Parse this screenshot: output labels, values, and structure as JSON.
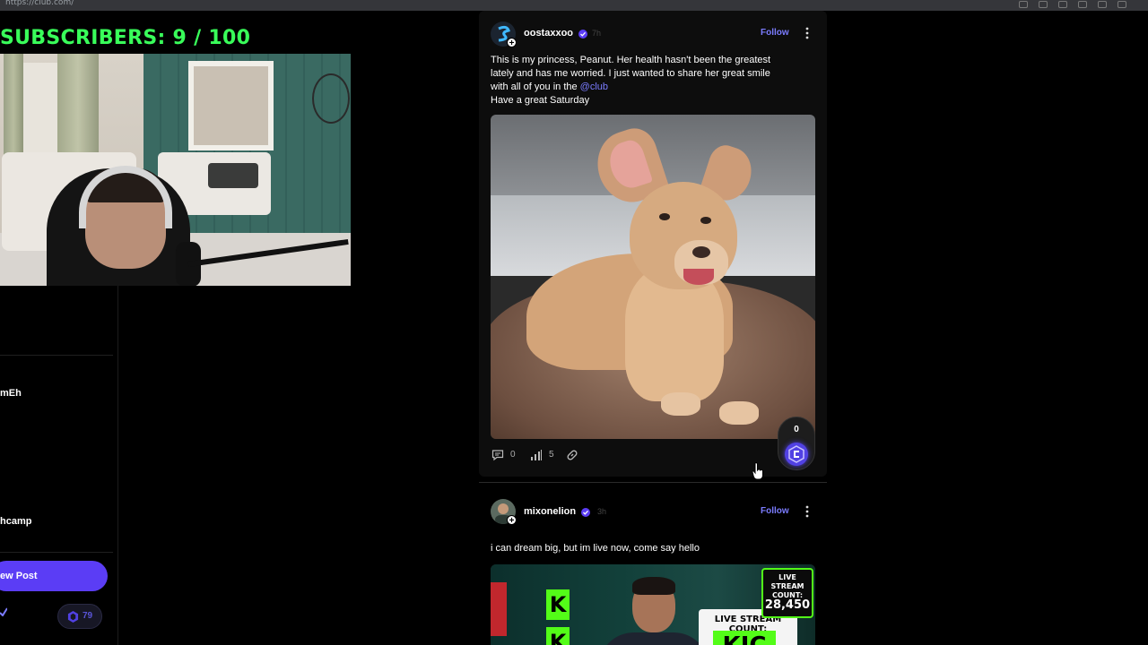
{
  "browser": {
    "url": "https://club.com/"
  },
  "stream_overlay": {
    "subscribers_label": "SUBSCRIBERS: 9 / 100"
  },
  "sidebar": {
    "items": [
      {
        "label": "mEh"
      },
      {
        "label": "hcamp"
      }
    ],
    "new_post_label": "ew Post",
    "points": "79"
  },
  "feed": {
    "posts": [
      {
        "username": "oostaxxoo",
        "time_ago": "7h",
        "follow_label": "Follow",
        "text_lines": [
          "This is my princess, Peanut. Her health hasn't been the greatest",
          "lately and has me worried. I just wanted to share her great smile",
          "with all of you in the "
        ],
        "mention": "@club",
        "last_line": "Have a great Saturday",
        "comments": "0",
        "views": "5",
        "reaction_count": "0"
      },
      {
        "username": "mixonelion",
        "time_ago": "3h",
        "follow_label": "Follow",
        "text": "i can dream big, but im live now, come say hello",
        "thumbnail": {
          "sign_title": "LIVE STREAM COUNT:",
          "sign_number": "28,450",
          "caption": "LIVE STREAM COUNT:",
          "big_text": "KIC",
          "k_letter": "K"
        }
      }
    ]
  },
  "colors": {
    "accent": "#7b7cff",
    "new_post_button": "#5b3df5",
    "subscriber_green": "#39ff5a",
    "kick_green": "#53fc18"
  }
}
